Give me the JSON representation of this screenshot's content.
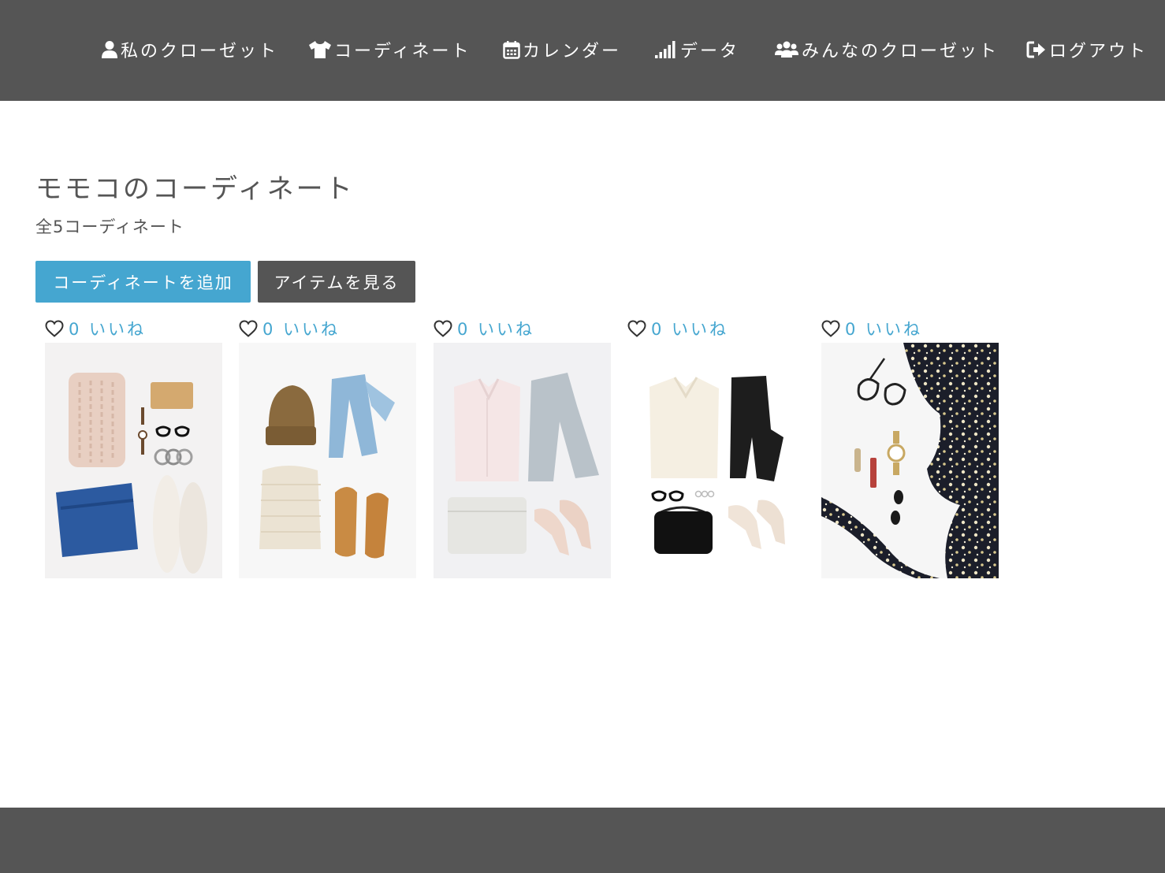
{
  "nav": {
    "items": [
      {
        "label": "私のクローゼット",
        "icon": "user-icon"
      },
      {
        "label": "コーディネート",
        "icon": "tshirt-icon"
      },
      {
        "label": "カレンダー",
        "icon": "calendar-icon"
      },
      {
        "label": "データ",
        "icon": "signal-bars-icon"
      },
      {
        "label": "みんなのクローゼット",
        "icon": "users-icon"
      },
      {
        "label": "ログアウト",
        "icon": "sign-out-icon"
      }
    ]
  },
  "main": {
    "title": "モモコのコーディネート",
    "summary": "全5コーディネート",
    "add_button": "コーディネートを追加",
    "items_button": "アイテムを見る"
  },
  "outfits": [
    {
      "like_label": "0 いいね",
      "icon": "heart-outline-icon",
      "photo": "outfit-photo-knit-jeans-sneakers"
    },
    {
      "like_label": "0 いいね",
      "icon": "heart-outline-icon",
      "photo": "outfit-photo-beanie-jeans-shoes"
    },
    {
      "like_label": "0 いいね",
      "icon": "heart-outline-icon",
      "photo": "outfit-photo-blouse-trousers-heels"
    },
    {
      "like_label": "0 いいね",
      "icon": "heart-outline-icon",
      "photo": "outfit-photo-blouse-black-pants-heels"
    },
    {
      "like_label": "0 いいね",
      "icon": "heart-outline-icon",
      "photo": "outfit-photo-floral-dress-accessories"
    }
  ],
  "colors": {
    "header_bg": "#555555",
    "accent": "#45a6d0",
    "text": "#555555",
    "footer_bg": "#555555"
  }
}
